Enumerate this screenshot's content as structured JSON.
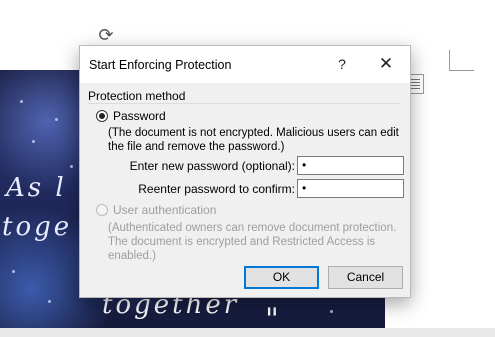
{
  "dialog": {
    "title": "Start Enforcing Protection",
    "help_label": "?",
    "close_label": "✕",
    "section_label": "Protection method",
    "password_option": {
      "label": "Password",
      "description": "(The document is not encrypted. Malicious users can edit the file and remove the password.)",
      "new_password_label": "Enter new password (optional):",
      "new_password_value": "•",
      "confirm_password_label": "Reenter password to confirm:",
      "confirm_password_value": "•"
    },
    "user_auth_option": {
      "label": "User authentication",
      "description": "(Authenticated owners can remove document protection. The document is encrypted and Restricted Access is enabled.)"
    },
    "ok_label": "OK",
    "cancel_label": "Cancel"
  },
  "document": {
    "line1": "As l",
    "line2": "toge",
    "line3": "together",
    "quote": "\""
  },
  "icons": {
    "rotate": "rotate-handle-icon",
    "layout": "layout-options-icon",
    "close": "close-icon"
  },
  "colors": {
    "dialog_bg": "#f0f0f0",
    "accent": "#0078d7",
    "disabled_text": "#9e9e9e"
  }
}
